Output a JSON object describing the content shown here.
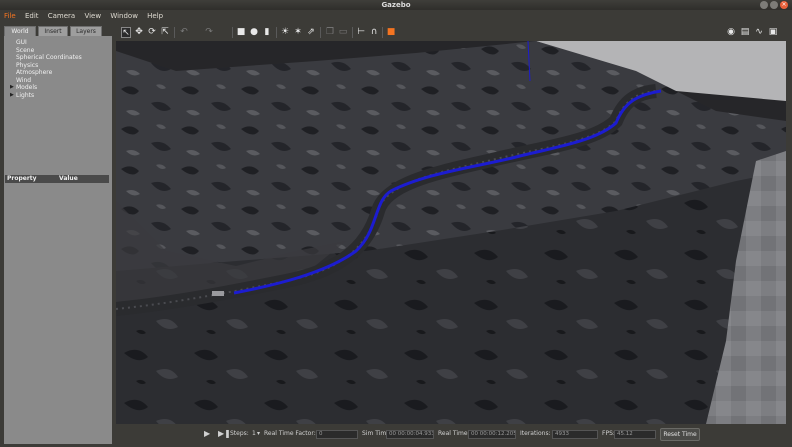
{
  "window": {
    "title": "Gazebo",
    "close_glyph": "×"
  },
  "menu": [
    "File",
    "Edit",
    "Camera",
    "View",
    "Window",
    "Help"
  ],
  "left_panel": {
    "tabs": [
      "World",
      "Insert",
      "Layers"
    ],
    "active_tab": "World",
    "tree": [
      "GUI",
      "Scene",
      "Spherical Coordinates",
      "Physics",
      "Atmosphere",
      "Wind",
      "Models",
      "Lights"
    ],
    "expandable": [
      "Models",
      "Lights"
    ],
    "properties_header": {
      "property": "Property",
      "value": "Value"
    }
  },
  "toolbar": {
    "tools": [
      "select-tool-icon",
      "translate-tool-icon",
      "rotate-tool-icon",
      "scale-tool-icon",
      "undo-icon",
      "redo-icon",
      "box-shape-icon",
      "sphere-shape-icon",
      "cylinder-shape-icon",
      "point-light-icon",
      "spot-light-icon",
      "directional-light-icon",
      "copy-icon",
      "paste-icon",
      "align-icon",
      "snap-icon",
      "change-view-icon"
    ],
    "right_tools": [
      "screenshot-icon",
      "log-icon",
      "plot-icon",
      "video-icon"
    ]
  },
  "bottom_bar": {
    "steps_label": "Steps:",
    "steps_value": "1",
    "rtf_label": "Real Time Factor:",
    "rtf_value": "0",
    "sim_time_label": "Sim Time:",
    "sim_time_value": "00 00:00:04.933",
    "real_time_label": "Real Time:",
    "real_time_value": "00 00:00:12.205",
    "iterations_label": "Iterations:",
    "iterations_value": "4933",
    "fps_label": "FPS:",
    "fps_value": "45.12",
    "reset_label": "Reset Time"
  },
  "colors": {
    "accent": "#f47421",
    "close_button": "#e8603a",
    "panel_bg": "#8a8a8a",
    "chrome_bg": "#3c3b37",
    "path_blue": "#1c1cd0"
  }
}
